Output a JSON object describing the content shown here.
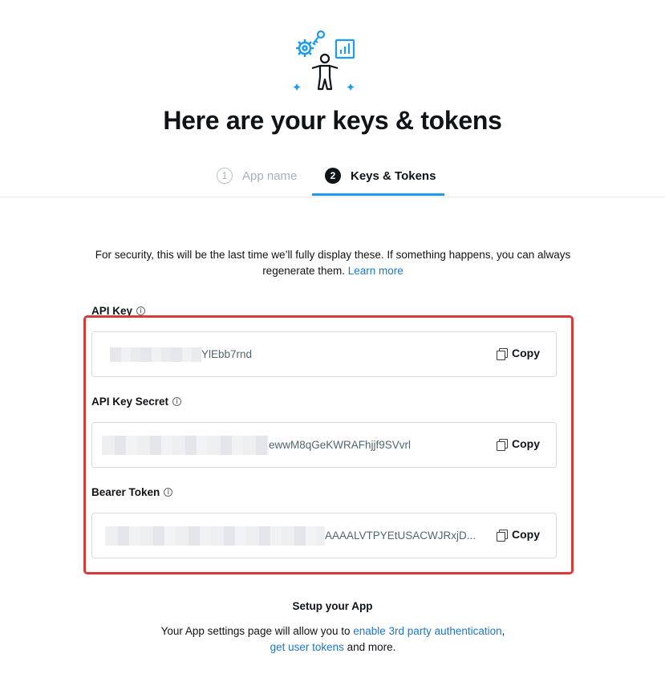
{
  "page": {
    "title": "Here are your keys & tokens"
  },
  "steps": [
    {
      "number": "1",
      "label": "App name",
      "active": false
    },
    {
      "number": "2",
      "label": "Keys & Tokens",
      "active": true
    }
  ],
  "notice": {
    "text": "For security, this will be the last time we’ll fully display these. If something happens, you can always regenerate them.",
    "link": "Learn more"
  },
  "credentials": [
    {
      "label": "API Key",
      "value_visible": "YlEbb7rnd",
      "copy_label": "Copy"
    },
    {
      "label": "API Key Secret",
      "value_visible": "ewwM8qGeKWRAFhjjf9SVvrl",
      "copy_label": "Copy"
    },
    {
      "label": "Bearer Token",
      "value_visible": "AAAALVTPYEtUSACWJRxjD...",
      "copy_label": "Copy"
    }
  ],
  "setup": {
    "title": "Setup your App",
    "text_before": "Your App settings page will allow you to ",
    "link1": "enable 3rd party authentication",
    "sep": ", ",
    "link2": "get user tokens",
    "text_after": " and more."
  },
  "colors": {
    "accent": "#1d9bf0",
    "link": "#1d77c8",
    "highlight_border": "#d93b3b"
  },
  "icons": [
    "gear-icon",
    "key-icon",
    "chart-icon",
    "person-icon",
    "sparkle-icon",
    "info-icon",
    "copy-icon"
  ]
}
